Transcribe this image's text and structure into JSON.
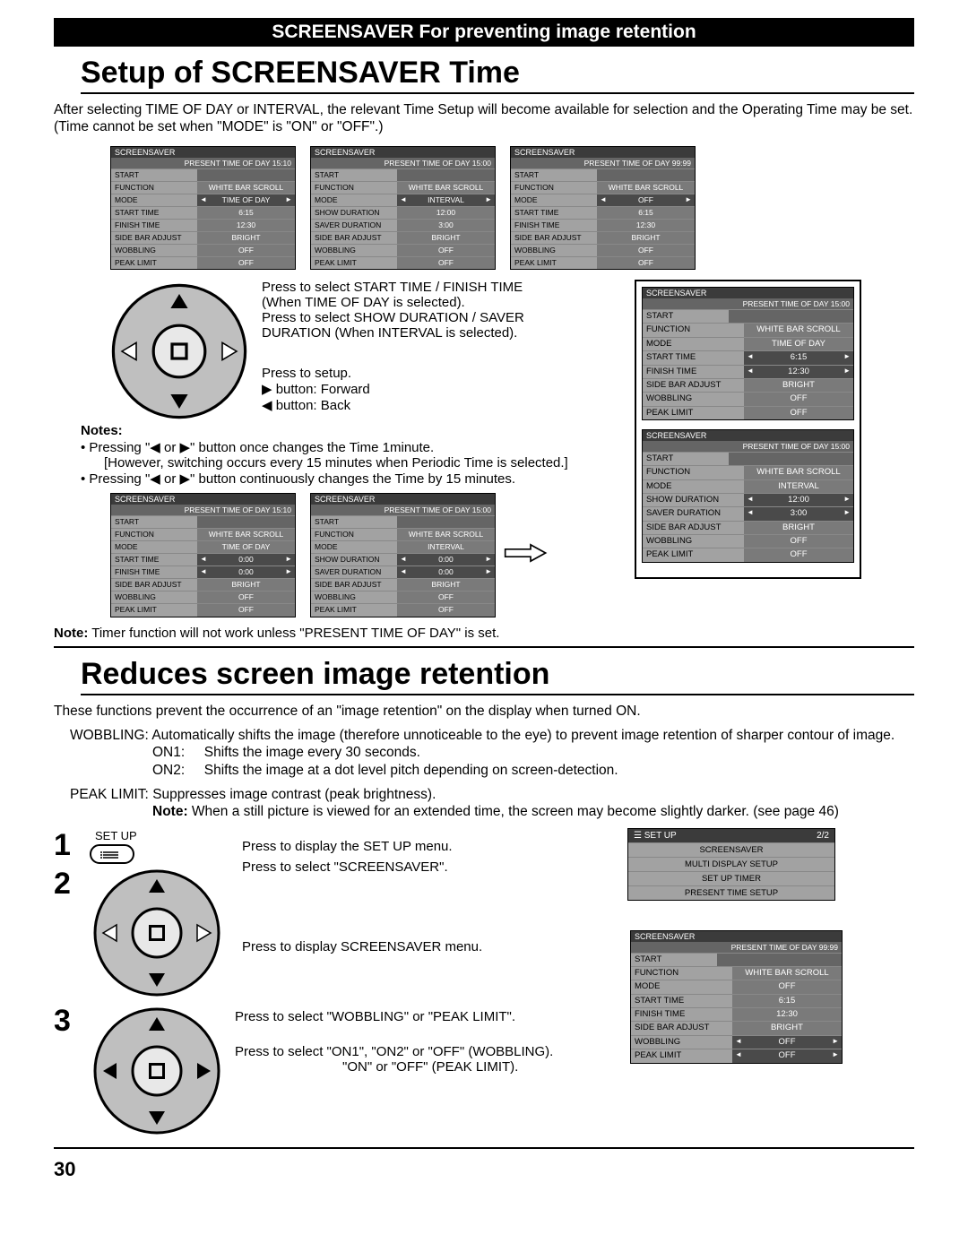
{
  "banner": "SCREENSAVER For preventing image retention",
  "section1_title": "Setup of SCREENSAVER Time",
  "intro": "After selecting TIME OF DAY or INTERVAL, the relevant Time Setup will become available for selection and the Operating Time may be set. (Time cannot be set when \"MODE\" is \"ON\" or \"OFF\".)",
  "osd_top": [
    {
      "title": "SCREENSAVER",
      "present": "PRESENT  TIME OF DAY    15:10",
      "rows": [
        [
          "START",
          ""
        ],
        [
          "FUNCTION",
          "WHITE BAR SCROLL"
        ],
        [
          "MODE",
          "TIME OF DAY",
          "hl"
        ],
        [
          "START TIME",
          "6:15"
        ],
        [
          "FINISH TIME",
          "12:30"
        ],
        [
          "SIDE BAR ADJUST",
          "BRIGHT"
        ],
        [
          "WOBBLING",
          "OFF"
        ],
        [
          "PEAK LIMIT",
          "OFF"
        ]
      ]
    },
    {
      "title": "SCREENSAVER",
      "present": "PRESENT  TIME OF DAY    15:00",
      "rows": [
        [
          "START",
          ""
        ],
        [
          "FUNCTION",
          "WHITE BAR SCROLL"
        ],
        [
          "MODE",
          "INTERVAL",
          "hl"
        ],
        [
          "SHOW DURATION",
          "12:00"
        ],
        [
          "SAVER DURATION",
          "3:00"
        ],
        [
          "SIDE BAR ADJUST",
          "BRIGHT"
        ],
        [
          "WOBBLING",
          "OFF"
        ],
        [
          "PEAK LIMIT",
          "OFF"
        ]
      ]
    },
    {
      "title": "SCREENSAVER",
      "present": "PRESENT  TIME OF DAY    99:99",
      "rows": [
        [
          "START",
          ""
        ],
        [
          "FUNCTION",
          "WHITE BAR SCROLL"
        ],
        [
          "MODE",
          "OFF",
          "hl"
        ],
        [
          "START TIME",
          "6:15"
        ],
        [
          "FINISH TIME",
          "12:30"
        ],
        [
          "SIDE BAR ADJUST",
          "BRIGHT"
        ],
        [
          "WOBBLING",
          "OFF"
        ],
        [
          "PEAK LIMIT",
          "OFF"
        ]
      ]
    }
  ],
  "instr1a": "Press to select START TIME / FINISH TIME",
  "instr1b": "(When TIME OF DAY is selected).",
  "instr1c": "Press to select SHOW DURATION / SAVER DURATION (When INTERVAL is selected).",
  "instr2a": "Press to setup.",
  "instr2b": "▶ button: Forward",
  "instr2c": "◀ button: Back",
  "notes_label": "Notes:",
  "notes_1": "• Pressing \"◀ or ▶\" button once changes the Time 1minute.",
  "notes_1b": "[However, switching occurs every 15 minutes when Periodic Time is selected.]",
  "notes_2": "• Pressing \"◀ or ▶\" button continuously changes the Time by 15 minutes.",
  "osd_mid": [
    {
      "title": "SCREENSAVER",
      "present": "PRESENT  TIME OF DAY    15:10",
      "rows": [
        [
          "START",
          ""
        ],
        [
          "FUNCTION",
          "WHITE BAR SCROLL"
        ],
        [
          "MODE",
          "TIME OF DAY"
        ],
        [
          "START TIME",
          "0:00",
          "hl"
        ],
        [
          "FINISH TIME",
          "0:00",
          "hl"
        ],
        [
          "SIDE BAR ADJUST",
          "BRIGHT"
        ],
        [
          "WOBBLING",
          "OFF"
        ],
        [
          "PEAK LIMIT",
          "OFF"
        ]
      ]
    },
    {
      "title": "SCREENSAVER",
      "present": "PRESENT  TIME OF DAY    15:00",
      "rows": [
        [
          "START",
          ""
        ],
        [
          "FUNCTION",
          "WHITE BAR SCROLL"
        ],
        [
          "MODE",
          "INTERVAL"
        ],
        [
          "SHOW DURATION",
          "0:00",
          "hl"
        ],
        [
          "SAVER DURATION",
          "0:00",
          "hl"
        ],
        [
          "SIDE BAR ADJUST",
          "BRIGHT"
        ],
        [
          "WOBBLING",
          "OFF"
        ],
        [
          "PEAK LIMIT",
          "OFF"
        ]
      ]
    }
  ],
  "osd_right": [
    {
      "title": "SCREENSAVER",
      "present": "PRESENT  TIME OF DAY    15:00",
      "rows": [
        [
          "START",
          ""
        ],
        [
          "FUNCTION",
          "WHITE BAR SCROLL"
        ],
        [
          "MODE",
          "TIME OF DAY"
        ],
        [
          "START TIME",
          "6:15",
          "hl"
        ],
        [
          "FINISH TIME",
          "12:30",
          "hl"
        ],
        [
          "SIDE BAR ADJUST",
          "BRIGHT"
        ],
        [
          "WOBBLING",
          "OFF"
        ],
        [
          "PEAK LIMIT",
          "OFF"
        ]
      ]
    },
    {
      "title": "SCREENSAVER",
      "present": "PRESENT  TIME OF DAY    15:00",
      "rows": [
        [
          "START",
          ""
        ],
        [
          "FUNCTION",
          "WHITE BAR SCROLL"
        ],
        [
          "MODE",
          "INTERVAL"
        ],
        [
          "SHOW DURATION",
          "12:00",
          "hl"
        ],
        [
          "SAVER DURATION",
          "3:00",
          "hl"
        ],
        [
          "SIDE BAR ADJUST",
          "BRIGHT"
        ],
        [
          "WOBBLING",
          "OFF"
        ],
        [
          "PEAK LIMIT",
          "OFF"
        ]
      ]
    }
  ],
  "note_timer": "Note: Timer function will not work unless \"PRESENT TIME OF DAY\" is set.",
  "section2_title": "Reduces screen image retention",
  "retention_intro": "These functions prevent the occurrence of an \"image retention\" on the display when turned ON.",
  "wobbling_label": "WOBBLING:",
  "wobbling_desc": "Automatically shifts the image (therefore unnoticeable to the eye) to prevent image retention of sharper contour of image.",
  "on1_label": "ON1:",
  "on1_desc": "Shifts the image every 30 seconds.",
  "on2_label": "ON2:",
  "on2_desc": "Shifts the image at a dot level pitch depending on screen-detection.",
  "peak_label": "PEAK LIMIT:",
  "peak_desc": "Suppresses image contrast (peak brightness).",
  "peak_note_bold": "Note:",
  "peak_note": " When a still picture is viewed for an extended time, the screen may become slightly darker. (see page 46)",
  "step1": "1",
  "step2": "2",
  "step3": "3",
  "setup_btn": "SET UP",
  "step1_text": "Press to display the SET UP menu.",
  "step2_text": "Press to select \"SCREENSAVER\".",
  "step2b_text": "Press to display SCREENSAVER menu.",
  "step3a_text": "Press to select \"WOBBLING\" or \"PEAK LIMIT\".",
  "step3b_text": "Press to select \"ON1\", \"ON2\" or \"OFF\" (WOBBLING).",
  "step3c_text": "\"ON\" or \"OFF\" (PEAK LIMIT).",
  "setup_menu": {
    "title": "SET UP",
    "page": "2/2",
    "items": [
      "SCREENSAVER",
      "MULTI DISPLAY SETUP",
      "SET UP TIMER",
      "PRESENT TIME SETUP"
    ]
  },
  "osd_bottom": {
    "title": "SCREENSAVER",
    "present": "PRESENT  TIME OF DAY    99:99",
    "rows": [
      [
        "START",
        ""
      ],
      [
        "FUNCTION",
        "WHITE BAR SCROLL"
      ],
      [
        "MODE",
        "OFF"
      ],
      [
        "START TIME",
        "6:15"
      ],
      [
        "FINISH TIME",
        "12:30"
      ],
      [
        "SIDE BAR ADJUST",
        "BRIGHT"
      ],
      [
        "WOBBLING",
        "OFF",
        "hl"
      ],
      [
        "PEAK LIMIT",
        "OFF",
        "hl"
      ]
    ]
  },
  "page_num": "30"
}
